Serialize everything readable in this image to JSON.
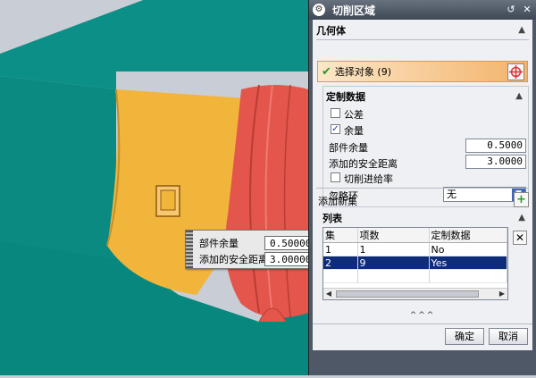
{
  "dialog": {
    "title": "切削区域",
    "reset_icon": "reset-icon",
    "close_icon": "close-icon",
    "geometry": {
      "header": "几何体",
      "select_label": "选择对象 (9)"
    },
    "custom": {
      "header": "定制数据",
      "tolerance_label": "公差",
      "tolerance_checked": false,
      "stock_checkbox_label": "余量",
      "stock_checked": true,
      "part_stock_label": "部件余量",
      "part_stock_value": "0.5000",
      "clearance_label": "添加的安全距离",
      "clearance_value": "3.0000",
      "feed_label": "切削进给率",
      "feed_checked": false,
      "ignore_loop_label": "忽略环",
      "ignore_loop_value": "无"
    },
    "add_set_label": "添加新集",
    "list": {
      "header": "列表",
      "columns": [
        "集",
        "项数",
        "定制数据"
      ],
      "rows": [
        {
          "set": "1",
          "count": "1",
          "custom": "No",
          "selected": false
        },
        {
          "set": "2",
          "count": "9",
          "custom": "Yes",
          "selected": true
        }
      ]
    },
    "more": "^^^",
    "ok_label": "确定",
    "cancel_label": "取消"
  },
  "tooltip": {
    "part_stock_label": "部件余量",
    "part_stock_value": "0.50000(",
    "clearance_label": "添加的安全距离",
    "clearance_value": "3.00000("
  },
  "colors": {
    "model_teal": "#0a8e85",
    "model_red": "#e4564b",
    "model_yellow": "#f2b53c",
    "accent_blue": "#0f2c7a"
  }
}
